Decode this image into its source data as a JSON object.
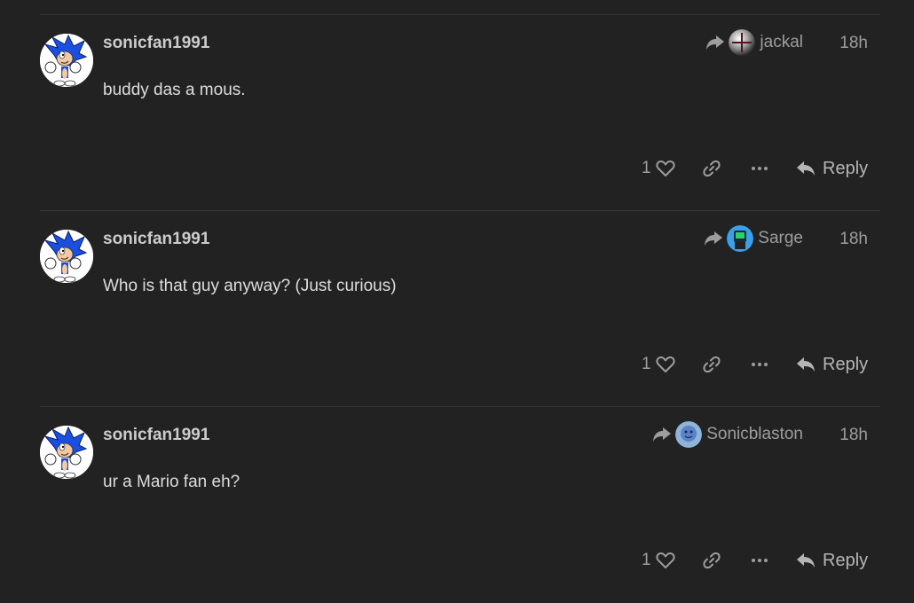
{
  "colors": {
    "background": "#222222",
    "separator": "#363636",
    "muted": "#9d9d9d",
    "text": "#dddddd"
  },
  "posts": [
    {
      "username": "sonicfan1991",
      "reply_to": "jackal",
      "reply_avatar": "silver-sphere",
      "time": "18h",
      "content": "buddy das a mous.",
      "likes": "1",
      "reply_label": "Reply"
    },
    {
      "username": "sonicfan1991",
      "reply_to": "Sarge",
      "reply_avatar": "blue-robot",
      "time": "18h",
      "content": "Who is that guy anyway? (Just curious)",
      "likes": "1",
      "reply_label": "Reply"
    },
    {
      "username": "sonicfan1991",
      "reply_to": "Sonicblaston",
      "reply_avatar": "blue-face",
      "time": "18h",
      "content": "ur a Mario fan eh?",
      "likes": "1",
      "reply_label": "Reply"
    }
  ]
}
